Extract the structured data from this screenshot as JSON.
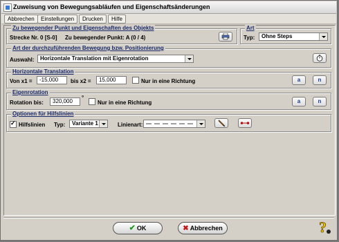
{
  "window": {
    "title": "Zuweisung von Bewegungsabläufen und Eigenschaftsänderungen"
  },
  "menu": [
    "Abbrechen",
    "Einstellungen",
    "Drucken",
    "Hilfe"
  ],
  "punkt": {
    "legend": "Zu bewegender Punkt und Eigenschaften des Objekts",
    "strecke_text": "Strecke Nr. 0 [S-0]",
    "punkt_text": "Zu bewegender Punkt: A (0 / 4)",
    "icon": "printer-icon"
  },
  "art": {
    "legend": "Art",
    "typ_label": "Typ:",
    "typ_value": "Ohne Steps"
  },
  "bewegung": {
    "legend": "Art der durchzuführenden Bewegung bzw. Positionierung",
    "auswahl_label": "Auswahl:",
    "auswahl_value": "Horizontale Translation mit Eigenrotation",
    "icon": "timer-icon"
  },
  "translation": {
    "legend": "Horizontale Translation",
    "von_label": "Von x1 =",
    "x1": "-15,000",
    "bis_label": "bis x2 =",
    "x2": "15,000",
    "check_label": "Nur in eine Richtung",
    "btn_a": "a",
    "btn_n": "n"
  },
  "rotation": {
    "legend": "Eigenrotation",
    "label": "Rotation bis:",
    "value": "320,000",
    "degree": "°",
    "check_label": "Nur in eine Richtung",
    "btn_a": "a",
    "btn_n": "n"
  },
  "hilfslinien": {
    "legend": "Optionen für Hilfslinien",
    "check_label": "Hilfslinien",
    "typ_label": "Typ:",
    "typ_value": "Variante 1",
    "linienart_label": "Linienart:",
    "pen_icon": "pen-icon",
    "line_icon": "line-endpoints-icon"
  },
  "footer": {
    "ok": "OK",
    "cancel": "Abbrechen",
    "help_icon": "help-icon"
  },
  "colors": {
    "accent": "#1d3c8a",
    "ok_green": "#1f9a1f",
    "cancel_red": "#c01818"
  }
}
